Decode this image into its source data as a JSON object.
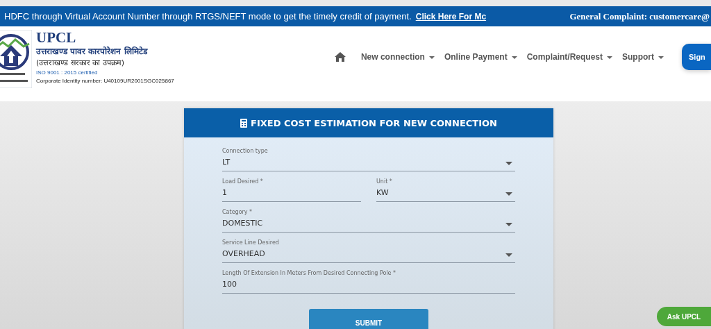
{
  "ticker": {
    "message": "HDFC through Virtual Account Number through RTGS/NEFT mode to get the timely credit of payment.",
    "link": "Click Here For Mc",
    "complaint": "General Complaint: customercare@"
  },
  "brand": {
    "name": "UPCL",
    "hindi_name": "उत्तराखण्ड पावर कारपोरेशन लिमिटेड",
    "hindi_tagline": "(उत्तराखण्ड सरकार का उपक्रम)",
    "iso": "ISO 9001 : 2015  certified",
    "cin": "Corporate Identity number:  U40109UR2001SGC025867"
  },
  "nav": {
    "items": [
      "New connection",
      "Online Payment",
      "Complaint/Request",
      "Support"
    ],
    "sign_button": "Sign"
  },
  "form": {
    "title": "FIXED COST ESTIMATION FOR NEW CONNECTION",
    "rows": [
      [
        {
          "kind": "select",
          "label": "Connection type",
          "value": "LT"
        }
      ],
      [
        {
          "kind": "input",
          "label": "Load Desired *",
          "value": "1"
        },
        {
          "kind": "select",
          "label": "Unit *",
          "value": "KW"
        }
      ],
      [
        {
          "kind": "select",
          "label": "Category *",
          "value": "DOMESTIC"
        }
      ],
      [
        {
          "kind": "select",
          "label": "Service Line Desired",
          "value": "OVERHEAD"
        }
      ],
      [
        {
          "kind": "input",
          "label": "Length Of Extension In Meters From Desired Connecting Pole *",
          "value": "100"
        }
      ]
    ],
    "submit": "SUBMIT"
  },
  "chat_button": "Ask UPCL"
}
